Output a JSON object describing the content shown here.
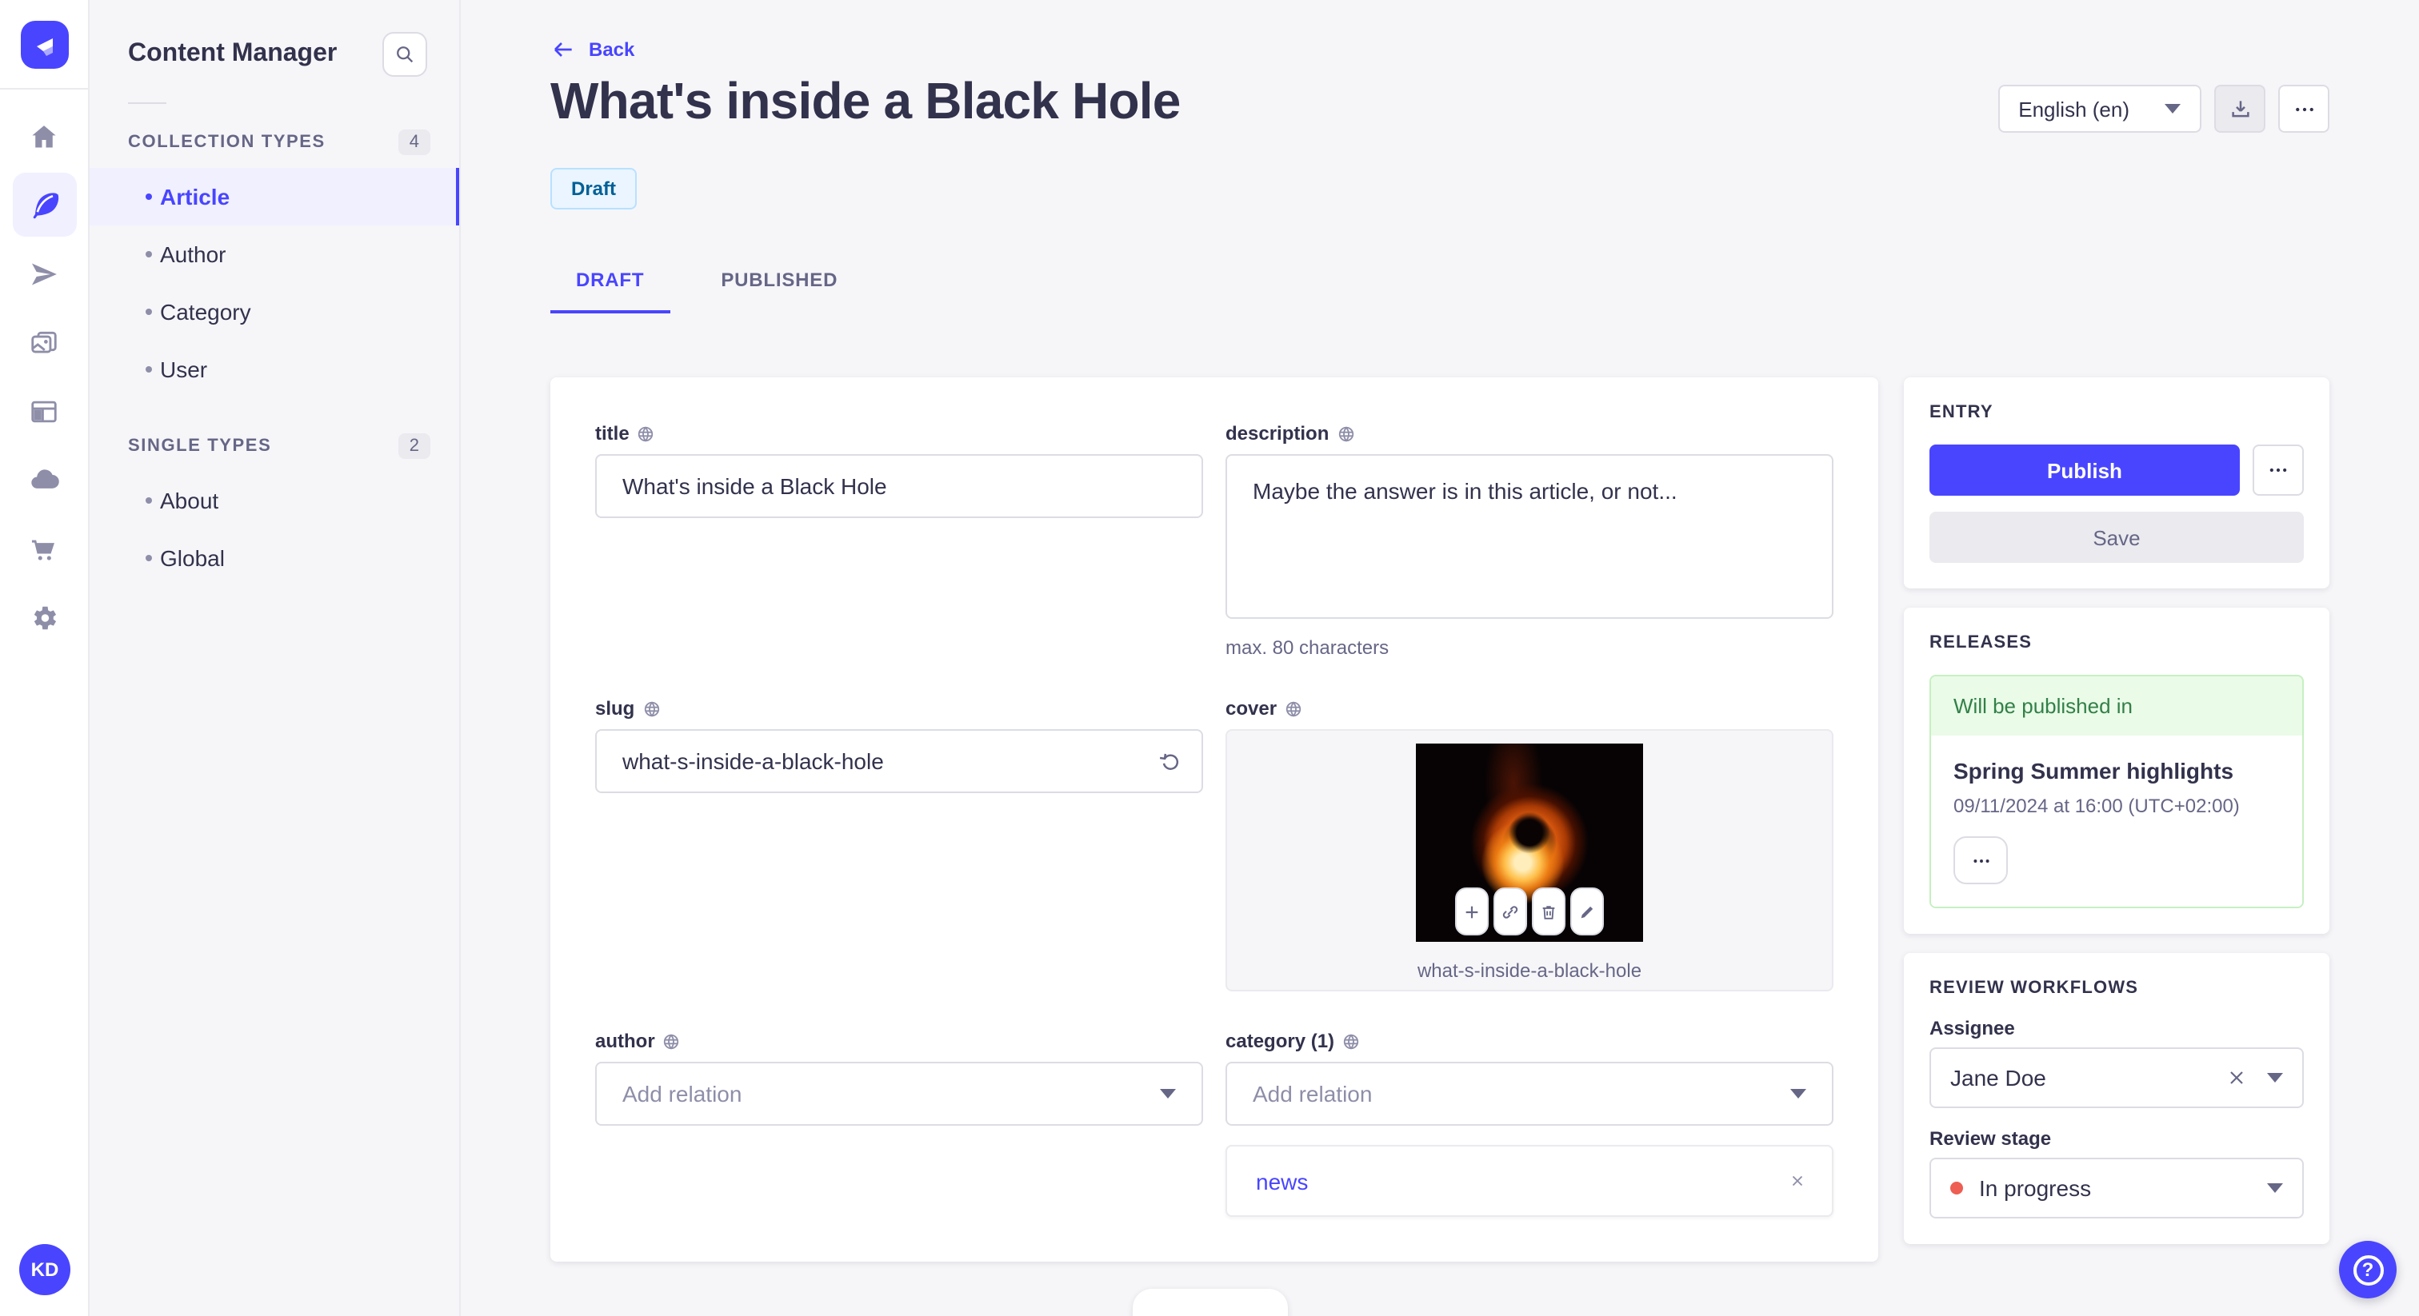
{
  "colors": {
    "primary": "#4945ff",
    "primary_light": "#f0f0ff",
    "draft_badge_text": "#006096",
    "draft_badge_bg": "#eaf5ff",
    "success_text": "#328048",
    "success_bg": "#eafbe7",
    "danger_dot": "#ee5e52",
    "background": "#f6f6f9"
  },
  "rail": {
    "avatar_initials": "KD"
  },
  "sidebar": {
    "title": "Content Manager",
    "sections": [
      {
        "label": "COLLECTION TYPES",
        "badge": "4",
        "items": [
          {
            "label": "Article"
          },
          {
            "label": "Author"
          },
          {
            "label": "Category"
          },
          {
            "label": "User"
          }
        ]
      },
      {
        "label": "SINGLE TYPES",
        "badge": "2",
        "items": [
          {
            "label": "About"
          },
          {
            "label": "Global"
          }
        ]
      }
    ]
  },
  "header": {
    "back_label": "Back",
    "title": "What's inside a Black Hole",
    "status": "Draft",
    "tab_draft": "DRAFT",
    "tab_published": "PUBLISHED",
    "locale": "English (en)"
  },
  "form": {
    "title": {
      "label": "title",
      "value": "What's inside a Black Hole"
    },
    "description": {
      "label": "description",
      "value": "Maybe the answer is in this article, or not...",
      "hint": "max. 80 characters"
    },
    "slug": {
      "label": "slug",
      "value": "what-s-inside-a-black-hole"
    },
    "cover": {
      "label": "cover",
      "filename": "what-s-inside-a-black-hole"
    },
    "author": {
      "label": "author",
      "placeholder": "Add relation"
    },
    "category": {
      "label": "category (1)",
      "placeholder": "Add relation",
      "selected": "news"
    }
  },
  "entry_panel": {
    "title": "ENTRY",
    "publish_label": "Publish",
    "save_label": "Save"
  },
  "releases_panel": {
    "title": "RELEASES",
    "banner": "Will be published in",
    "release_name": "Spring Summer highlights",
    "release_date": "09/11/2024 at 16:00 (UTC+02:00)"
  },
  "review_panel": {
    "title": "REVIEW WORKFLOWS",
    "assignee_label": "Assignee",
    "assignee_value": "Jane Doe",
    "stage_label": "Review stage",
    "stage_value": "In progress"
  }
}
